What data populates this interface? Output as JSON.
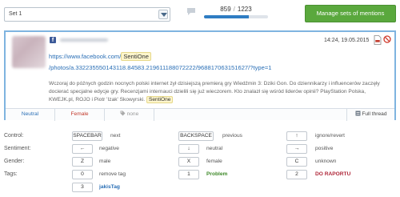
{
  "toolbar": {
    "set_select_value": "Set 1",
    "counter_done": "859",
    "counter_sep": "/",
    "counter_total": "1223",
    "progress_fraction": 0.7,
    "manage_button": "Manage sets of mentions"
  },
  "mention": {
    "source_icon": "facebook-icon",
    "datetime": "14:24, 19.05.2015",
    "link_line1_prefix": "https://www.facebook.com/",
    "link_line1_highlight": "SentiOne",
    "link_line2": "/photos/a.332235550143118.84583.219611188072222/968817063151627/?type=1",
    "body": "Wczoraj do późnych godzin nocnych polski internet żył dzisiejszą premierą gry Wiedźmin 3: Dziki Gon. Do dziennikarzy i influencerów zaczęły docierać specjalne edycje gry. Recenzjami internauci dzielili się już wieczorem. Kto znalazł się wśród liderów opinii? PlayStation Polska, KWEJK.pl, ROJO i Piotr 'Izak' Skowyrski.",
    "body_highlight": "SentiOne",
    "footer": {
      "sentiment": "Neutral",
      "gender": "Female",
      "tag": "none",
      "full_thread": "Full thread"
    }
  },
  "shortcuts": {
    "control_label": "Control:",
    "sentiment_label": "Sentiment:",
    "gender_label": "Gender:",
    "tags_label": "Tags:",
    "control": [
      {
        "key": "SPACEBAR",
        "desc": "next"
      },
      {
        "key": "BACKSPACE",
        "desc": "previous"
      },
      {
        "key": "↑",
        "desc": "ignore/revert"
      }
    ],
    "sentiment": [
      {
        "key": "←",
        "desc": "negative"
      },
      {
        "key": "↓",
        "desc": "neutral"
      },
      {
        "key": "→",
        "desc": "positive"
      }
    ],
    "gender": [
      {
        "key": "Z",
        "desc": "male"
      },
      {
        "key": "X",
        "desc": "female"
      },
      {
        "key": "C",
        "desc": "unknown"
      }
    ],
    "tags": [
      {
        "key": "0",
        "desc": "remove tag"
      },
      {
        "key": "1",
        "desc": "Problem"
      },
      {
        "key": "2",
        "desc": "DO RAPORTU"
      },
      {
        "key": "3",
        "desc": "jakisTag"
      }
    ]
  }
}
